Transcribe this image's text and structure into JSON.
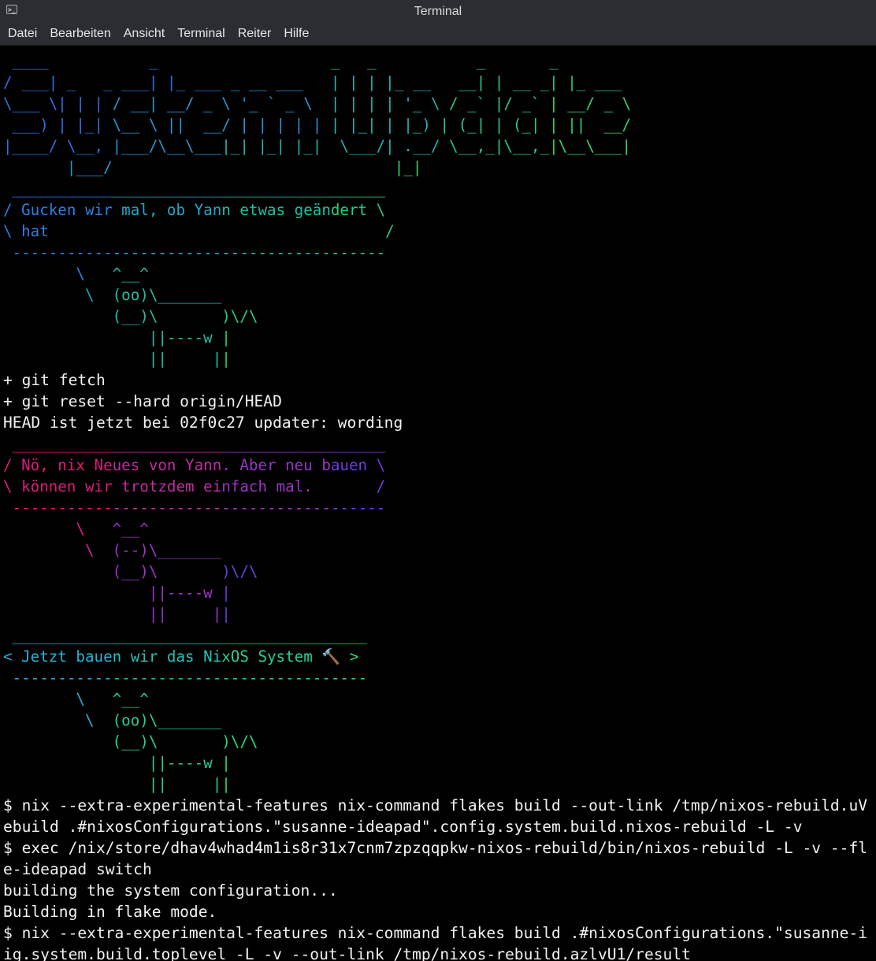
{
  "window": {
    "title": "Terminal",
    "app_icon": "terminal-icon"
  },
  "menu": [
    "Datei",
    "Bearbeiten",
    "Ansicht",
    "Terminal",
    "Reiter",
    "Hilfe"
  ],
  "colors": {
    "background": "#000000",
    "text": "#f2f2f2",
    "banner_gradient": [
      "#2f6fe0",
      "#2a95d6",
      "#26b3b0",
      "#27c98a",
      "#33d66a",
      "#5ad84f"
    ],
    "cow1_gradient": [
      "#2d7fe6",
      "#22a7c8",
      "#1fbfa4",
      "#22cf82",
      "#2fd86a",
      "#3fde58"
    ],
    "cow2_gradient": [
      "#e0197a",
      "#c42aa0",
      "#9b33c8",
      "#6e3ce2",
      "#4b48ea",
      "#3a55ec"
    ],
    "cow3_gradient": [
      "#27b0d8",
      "#22c2b6",
      "#24cf96",
      "#2cd97c",
      "#38df66",
      "#4ae357"
    ]
  },
  "banner": [
    " ____           _                   _   _           _       _",
    "/ ___| _   _ ___| |_ ___ _ __ ___   | | | |_ __   __| | __ _| |_ ___",
    "\\___ \\| | | / __| __/ _ \\ '_ ` _ \\  | | | | '_ \\ / _` |/ _` | __/ _ \\",
    " ___) | |_| \\__ \\ ||  __/ | | | | | | |_| | |_) | (_| | (_| | ||  __/",
    "|____/ \\__, |___/\\__\\___|_| |_| |_|  \\___/| .__/ \\__,_|\\__,_|\\__\\___|",
    "       |___/                               |_|"
  ],
  "cow1": [
    " _________________________________________",
    "/ Gucken wir mal, ob Yann etwas geändert \\",
    "\\ hat                                     /",
    " -----------------------------------------",
    "        \\   ^__^",
    "         \\  (oo)\\_______",
    "            (__)\\       )\\/\\",
    "                ||----w |",
    "                ||     ||"
  ],
  "git_output": [
    "+ git fetch",
    "+ git reset --hard origin/HEAD",
    "HEAD ist jetzt bei 02f0c27 updater: wording"
  ],
  "cow2": [
    " _________________________________________",
    "/ Nö, nix Neues von Yann. Aber neu bauen \\",
    "\\ können wir trotzdem einfach mal.       /",
    " -----------------------------------------",
    "        \\   ^__^",
    "         \\  (--)\\_______",
    "            (__)\\       )\\/\\",
    "                ||----w |",
    "                ||     ||"
  ],
  "cow3": [
    " _______________________________________",
    "< Jetzt bauen wir das NixOS System 🔨 >",
    " ---------------------------------------",
    "        \\   ^__^",
    "         \\  (oo)\\_______",
    "            (__)\\       )\\/\\",
    "                ||----w |",
    "                ||     ||"
  ],
  "build_output": [
    "$ nix --extra-experimental-features nix-command flakes build --out-link /tmp/nixos-rebuild.uV",
    "ebuild .#nixosConfigurations.\"susanne-ideapad\".config.system.build.nixos-rebuild -L -v",
    "$ exec /nix/store/dhav4whad4m1is8r31x7cnm7zpzqqpkw-nixos-rebuild/bin/nixos-rebuild -L -v --fl",
    "e-ideapad switch",
    "building the system configuration...",
    "Building in flake mode.",
    "$ nix --extra-experimental-features nix-command flakes build .#nixosConfigurations.\"susanne-i",
    "ig.system.build.toplevel -L -v --out-link /tmp/nixos-rebuild.azlvU1/result"
  ]
}
